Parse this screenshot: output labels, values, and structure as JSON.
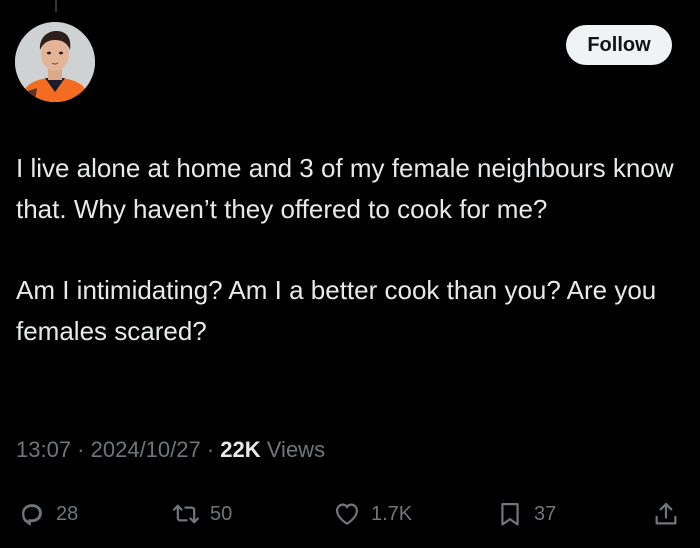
{
  "tweet": {
    "paragraphs": [
      "I live alone at home and 3 of my female neighbours know that. Why haven’t they offered to cook for me?",
      "Am I intimidating? Am I a better cook than you? Are you females scared?"
    ],
    "time": "13:07",
    "date": "2024/10/27",
    "separator": " · ",
    "views_count": "22K",
    "views_label": "Views"
  },
  "header": {
    "follow_label": "Follow",
    "avatar_icon": "profile-photo"
  },
  "actions": {
    "reply": {
      "icon": "reply-icon",
      "count": "28"
    },
    "retweet": {
      "icon": "retweet-icon",
      "count": "50"
    },
    "like": {
      "icon": "heart-icon",
      "count": "1.7K"
    },
    "bookmark": {
      "icon": "bookmark-icon",
      "count": "37"
    },
    "share": {
      "icon": "share-icon"
    }
  },
  "colors": {
    "background": "#000000",
    "text": "#e7e9ea",
    "secondary": "#71767b",
    "button_bg": "#eff3f4",
    "button_text": "#0f1419",
    "jersey": "#f36c21"
  }
}
